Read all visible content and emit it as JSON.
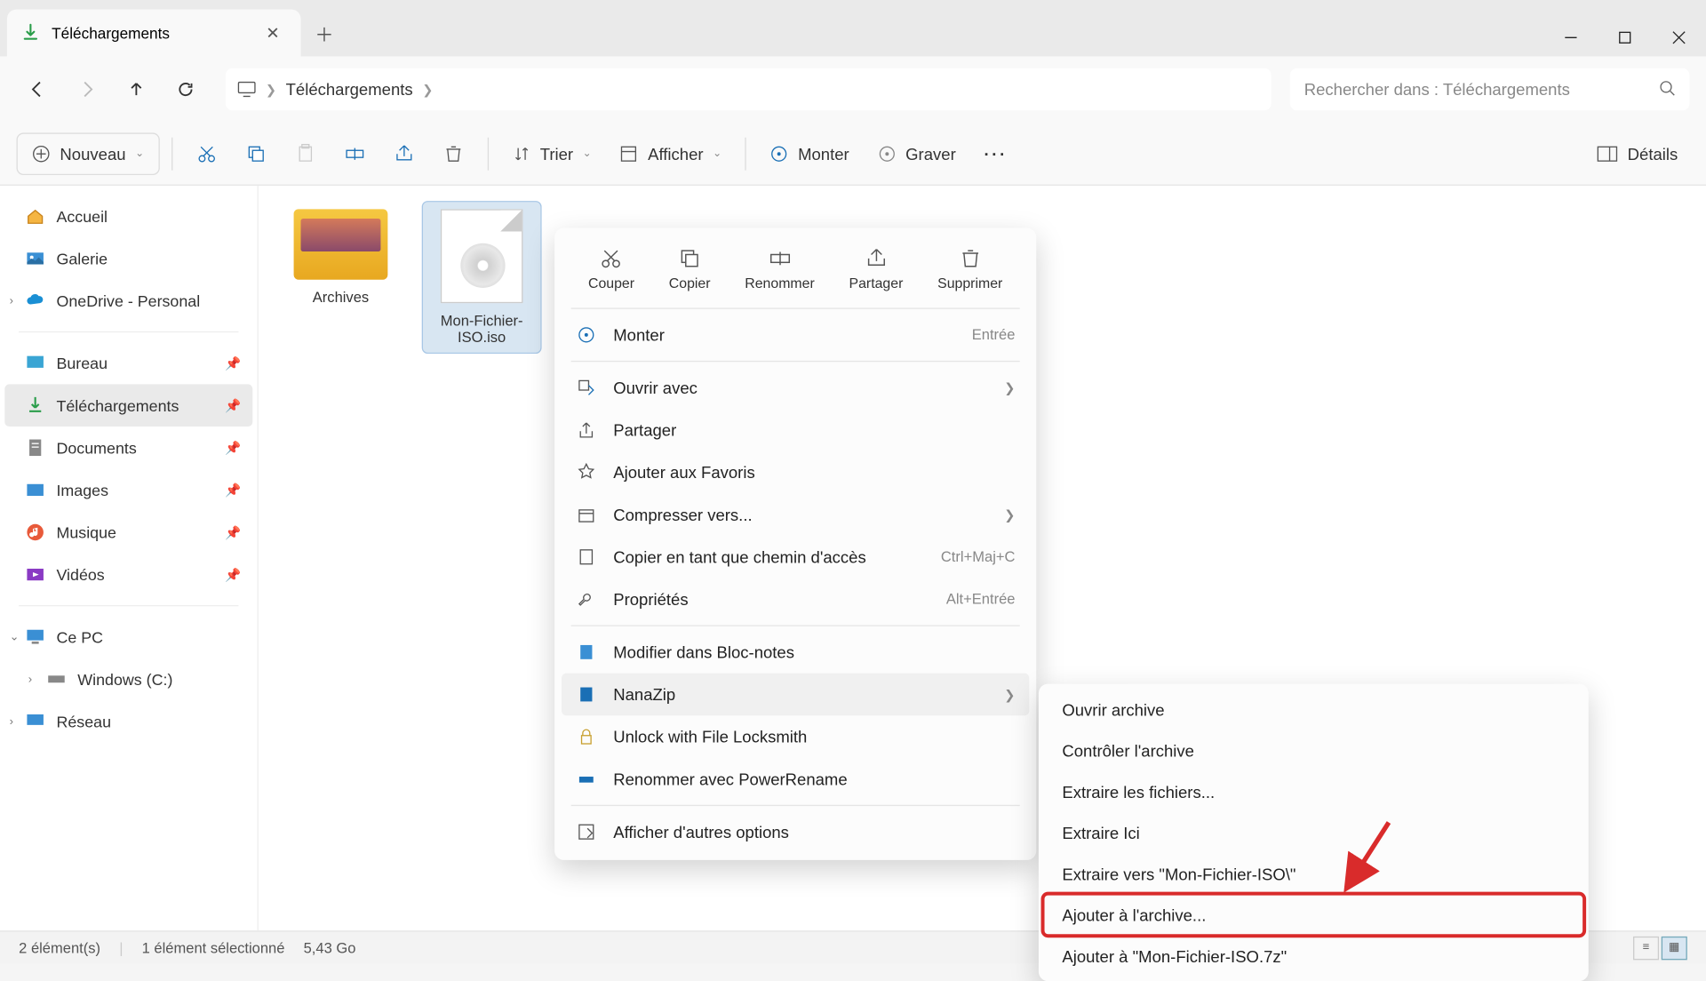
{
  "tab": {
    "title": "Téléchargements"
  },
  "breadcrumb": {
    "current": "Téléchargements"
  },
  "search": {
    "placeholder": "Rechercher dans : Téléchargements"
  },
  "toolbar": {
    "new": "Nouveau",
    "sort": "Trier",
    "view": "Afficher",
    "mount": "Monter",
    "burn": "Graver",
    "details": "Détails"
  },
  "sidebar": {
    "home": "Accueil",
    "gallery": "Galerie",
    "onedrive": "OneDrive - Personal",
    "desktop": "Bureau",
    "downloads": "Téléchargements",
    "documents": "Documents",
    "images": "Images",
    "music": "Musique",
    "videos": "Vidéos",
    "thispc": "Ce PC",
    "cdrive": "Windows (C:)",
    "network": "Réseau"
  },
  "items": {
    "folder1": "Archives",
    "file1": "Mon-Fichier-ISO.iso"
  },
  "ctx_top": {
    "cut": "Couper",
    "copy": "Copier",
    "rename": "Renommer",
    "share": "Partager",
    "delete": "Supprimer"
  },
  "ctx": {
    "mount": "Monter",
    "mount_hint": "Entrée",
    "openwith": "Ouvrir avec",
    "share": "Partager",
    "favorite": "Ajouter aux Favoris",
    "compress": "Compresser vers...",
    "copypath": "Copier en tant que chemin d'accès",
    "copypath_hint": "Ctrl+Maj+C",
    "properties": "Propriétés",
    "properties_hint": "Alt+Entrée",
    "notepad": "Modifier dans Bloc-notes",
    "nanazip": "NanaZip",
    "locksmith": "Unlock with File Locksmith",
    "powerrename": "Renommer avec PowerRename",
    "moreoptions": "Afficher d'autres options"
  },
  "submenu": {
    "open": "Ouvrir archive",
    "check": "Contrôler l'archive",
    "extract_files": "Extraire les fichiers...",
    "extract_here": "Extraire Ici",
    "extract_to": "Extraire vers \"Mon-Fichier-ISO\\\"",
    "add_archive": "Ajouter à l'archive...",
    "add_7z": "Ajouter à \"Mon-Fichier-ISO.7z\""
  },
  "status": {
    "count": "2 élément(s)",
    "selected": "1 élément sélectionné",
    "size": "5,43 Go"
  }
}
